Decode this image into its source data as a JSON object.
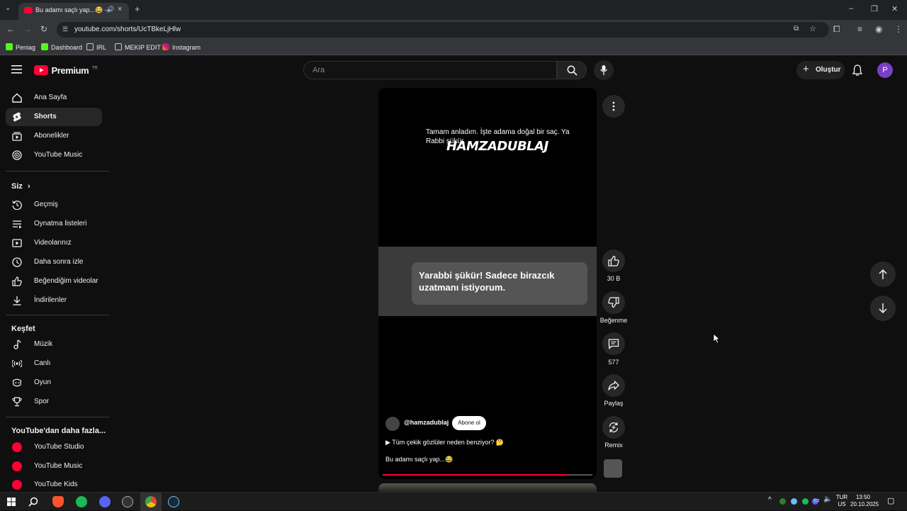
{
  "browser": {
    "tab_title": "Bu adamı saçlı yap...😂 - Yo",
    "url": "youtube.com/shorts/UcTBkeLjHlw",
    "bookmarks": [
      "Peniag",
      "Dashboard",
      "IRL",
      "MEKIP EDIT",
      "Instagram"
    ]
  },
  "header": {
    "logo_text": "Premium",
    "logo_region": "TR",
    "search_placeholder": "Ara",
    "create_label": "Oluştur",
    "avatar_letter": "P"
  },
  "sidebar": {
    "main": [
      "Ana Sayfa",
      "Shorts",
      "Abonelikler",
      "YouTube Music"
    ],
    "you_heading": "Siz",
    "you_items": [
      "Geçmiş",
      "Oynatma listeleri",
      "Videolarınız",
      "Daha sonra izle",
      "Beğendiğim videolar",
      "İndirilenler"
    ],
    "explore_heading": "Keşfet",
    "explore_items": [
      "Müzik",
      "Canlı",
      "Oyun",
      "Spor"
    ],
    "more_heading": "YouTube'dan daha fazla...",
    "more_items": [
      "YouTube Studio",
      "YouTube Music",
      "YouTube Kids"
    ]
  },
  "player": {
    "subtitle": "Tamam anladım. İşte adama doğal bir saç. Ya Rabbi şükür.",
    "logo_text": "HAMZADUBLAJ",
    "bubble_text": "Yarabbi şükür! Sadece birazcık uzatmanı istiyorum.",
    "channel": "@hamzadublaj",
    "subscribe_label": "Abone ol",
    "related": "▶  Tüm çekik gözlüler neden benziyor? 🤔",
    "title": "Bu adamı saçlı yap...😂",
    "progress": 0.88
  },
  "actions": {
    "likes": "30 B",
    "dislike_label": "Beğenme",
    "comments": "577",
    "share_label": "Paylaş",
    "remix_label": "Remix"
  },
  "taskbar": {
    "lang_1": "TUR",
    "lang_2": "US",
    "time": "13:50",
    "date": "20.10.2025"
  },
  "colors": {
    "brand_red": "#ff0033",
    "bg": "#0f0f0f",
    "avatar": "#7b3fc4"
  }
}
